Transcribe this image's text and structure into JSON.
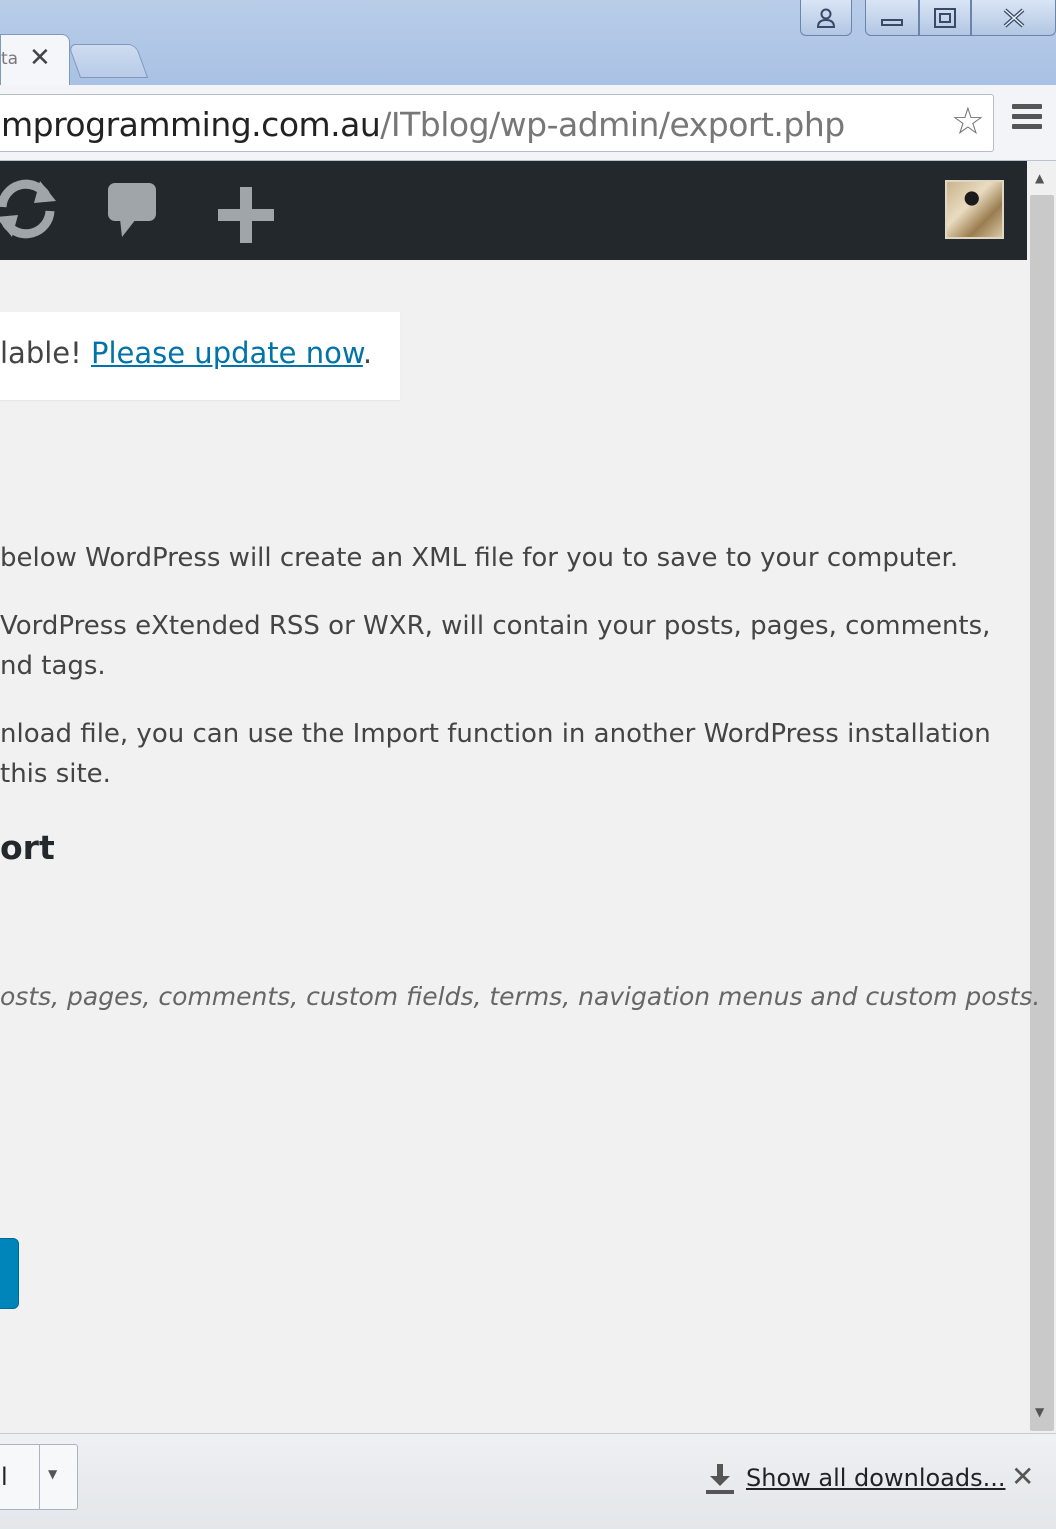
{
  "browser": {
    "tab_title_fragment": "ta",
    "tab_close_glyph": "✕",
    "url_host": "mprogramming.com.au",
    "url_path": "/ITblog/wp-admin/export.php",
    "star_glyph": "☆"
  },
  "admin_bar": {
    "icons": [
      "updates-icon",
      "comments-icon",
      "new-content-icon"
    ],
    "avatar": "user-avatar"
  },
  "notice": {
    "text_prefix": "lable! ",
    "link_text": "Please update now",
    "suffix": "."
  },
  "content": {
    "para1": "below WordPress will create an XML file for you to save to your computer.",
    "para2_line1": "VordPress eXtended RSS or WXR, will contain your posts, pages, comments,",
    "para2_line2": "nd tags.",
    "para3_line1": "nload file, you can use the Import function in another WordPress installation",
    "para3_line2": " this site.",
    "heading": "ort",
    "all_content_description": "osts, pages, comments, custom fields, terms, navigation menus and custom posts."
  },
  "downloads_shelf": {
    "item_text": "l",
    "show_all_label": "Show all downloads...",
    "close_glyph": "✕"
  },
  "colors": {
    "admin_bar": "#23282d",
    "link": "#0073aa",
    "button": "#0085ba",
    "page_bg": "#f1f1f1"
  }
}
